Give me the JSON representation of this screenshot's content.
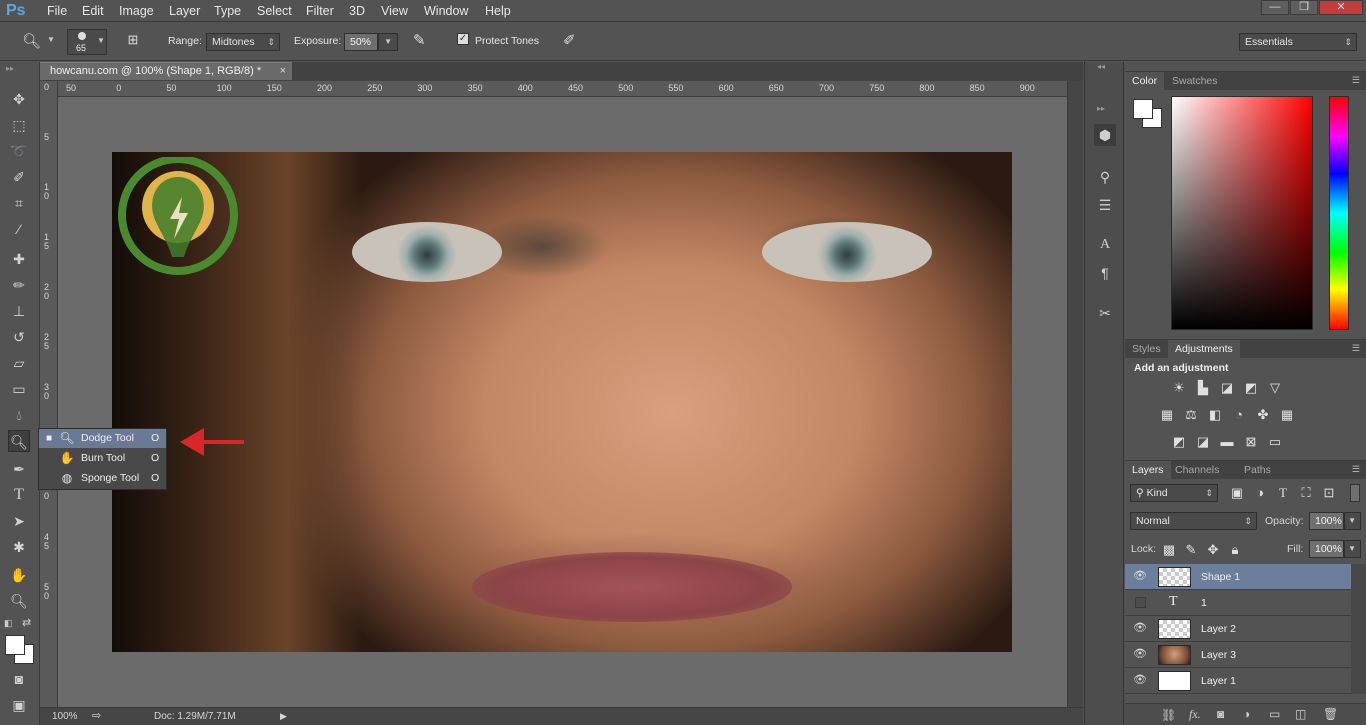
{
  "app": {
    "logo": "Ps"
  },
  "menu": [
    "File",
    "Edit",
    "Image",
    "Layer",
    "Type",
    "Select",
    "Filter",
    "3D",
    "View",
    "Window",
    "Help"
  ],
  "window_controls": {
    "minimize": "—",
    "restore": "❐",
    "close": "✕"
  },
  "options": {
    "brush_size": "65",
    "range_label": "Range:",
    "range_value": "Midtones",
    "exposure_label": "Exposure:",
    "exposure_value": "50%",
    "protect_tones_label": "Protect Tones",
    "protect_tones_checked": true,
    "workspace": "Essentials"
  },
  "document": {
    "tab_title": "howcanu.com @ 100% (Shape 1, RGB/8) *",
    "zoom": "100%",
    "doc_size": "Doc: 1.29M/7.71M"
  },
  "ruler": {
    "top": [
      "50",
      "0",
      "50",
      "100",
      "150",
      "200",
      "250",
      "300",
      "350",
      "400",
      "450",
      "500",
      "550",
      "600",
      "650",
      "700",
      "750",
      "800",
      "850",
      "900"
    ],
    "left": [
      "0",
      "5",
      "1 0",
      "1 5",
      "2 0",
      "2 5",
      "3 0",
      "3 5",
      "4 0",
      "4 5",
      "5 0"
    ]
  },
  "tools": {
    "items": [
      "move-tool",
      "marquee-tool",
      "lasso-tool",
      "quick-selection-tool",
      "crop-tool",
      "eyedropper-tool",
      "healing-brush-tool",
      "brush-tool",
      "clone-stamp-tool",
      "history-brush-tool",
      "eraser-tool",
      "gradient-tool",
      "blur-tool",
      "dodge-tool",
      "pen-tool",
      "type-tool",
      "path-selection-tool",
      "shape-tool",
      "hand-tool",
      "zoom-tool"
    ]
  },
  "flyout": [
    {
      "label": "Dodge Tool",
      "key": "O",
      "icon": "dodge-icon",
      "selected": true
    },
    {
      "label": "Burn Tool",
      "key": "O",
      "icon": "burn-icon",
      "selected": false
    },
    {
      "label": "Sponge Tool",
      "key": "O",
      "icon": "sponge-icon",
      "selected": false
    }
  ],
  "color_panel": {
    "tabs": [
      "Color",
      "Swatches"
    ],
    "foreground": "#ffffff",
    "background": "#ffffff"
  },
  "adjustments_panel": {
    "tabs": [
      "Styles",
      "Adjustments"
    ],
    "heading": "Add an adjustment",
    "icons": [
      "brightness-contrast-icon",
      "levels-icon",
      "curves-icon",
      "exposure-icon",
      "vibrance-icon",
      "hue-saturation-icon",
      "color-balance-icon",
      "black-white-icon",
      "photo-filter-icon",
      "channel-mixer-icon",
      "color-lookup-icon",
      "invert-icon",
      "posterize-icon",
      "threshold-icon",
      "selective-color-icon",
      "gradient-map-icon"
    ]
  },
  "layers_panel": {
    "tabs": [
      "Layers",
      "Channels",
      "Paths"
    ],
    "filter": "Kind",
    "blend_mode": "Normal",
    "opacity_label": "Opacity:",
    "opacity_value": "100%",
    "lock_label": "Lock:",
    "fill_label": "Fill:",
    "fill_value": "100%",
    "layers": [
      {
        "name": "Shape 1",
        "visible": true,
        "selected": true,
        "thumb": "transparent"
      },
      {
        "name": "1",
        "visible": false,
        "selected": false,
        "thumb": "type"
      },
      {
        "name": "Layer 2",
        "visible": true,
        "selected": false,
        "thumb": "transparent"
      },
      {
        "name": "Layer 3",
        "visible": true,
        "selected": false,
        "thumb": "photo"
      },
      {
        "name": "Layer 1",
        "visible": true,
        "selected": false,
        "thumb": "white"
      }
    ],
    "footer_icons": [
      "link-icon",
      "fx-icon",
      "mask-icon",
      "adjustment-layer-icon",
      "group-icon",
      "new-layer-icon",
      "trash-icon"
    ]
  },
  "colors": {
    "accent_selected": "#6b7f9c",
    "arrow": "#d8262b",
    "logo_green": "#4a8a2f"
  }
}
